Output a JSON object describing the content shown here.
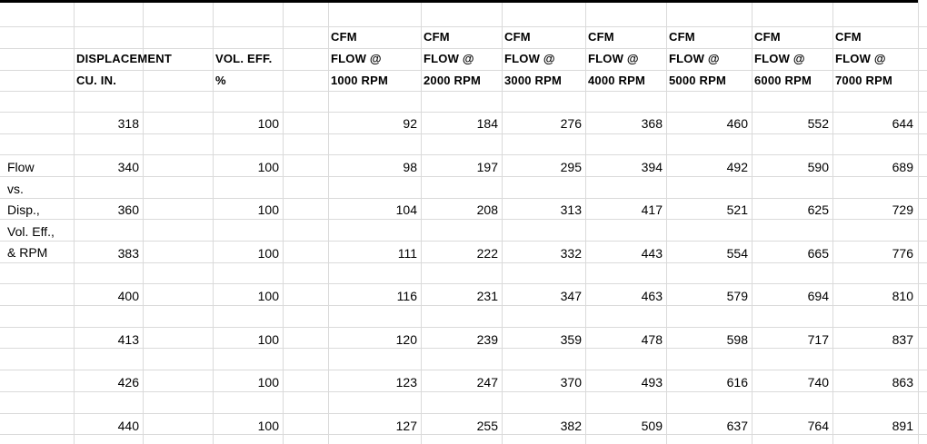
{
  "sheet": {
    "side_label": [
      "Flow",
      "vs.",
      "Disp.,",
      "Vol. Eff.,",
      "& RPM"
    ],
    "headers": [
      [
        "DISPLACEMENT",
        "CU. IN."
      ],
      [
        "VOL. EFF.",
        "%"
      ],
      [
        "CFM",
        "FLOW @",
        "1000 RPM"
      ],
      [
        "CFM",
        "FLOW @",
        "2000 RPM"
      ],
      [
        "CFM",
        "FLOW @",
        "3000 RPM"
      ],
      [
        "CFM",
        "FLOW @",
        "4000 RPM"
      ],
      [
        "CFM",
        "FLOW @",
        "5000 RPM"
      ],
      [
        "CFM",
        "FLOW @",
        "6000 RPM"
      ],
      [
        "CFM",
        "FLOW @",
        "7000 RPM"
      ]
    ],
    "rows": [
      [
        "318",
        "100",
        "92",
        "184",
        "276",
        "368",
        "460",
        "552",
        "644"
      ],
      [
        "340",
        "100",
        "98",
        "197",
        "295",
        "394",
        "492",
        "590",
        "689"
      ],
      [
        "360",
        "100",
        "104",
        "208",
        "313",
        "417",
        "521",
        "625",
        "729"
      ],
      [
        "383",
        "100",
        "111",
        "222",
        "332",
        "443",
        "554",
        "665",
        "776"
      ],
      [
        "400",
        "100",
        "116",
        "231",
        "347",
        "463",
        "579",
        "694",
        "810"
      ],
      [
        "413",
        "100",
        "120",
        "239",
        "359",
        "478",
        "598",
        "717",
        "837"
      ],
      [
        "426",
        "100",
        "123",
        "247",
        "370",
        "493",
        "616",
        "740",
        "863"
      ],
      [
        "440",
        "100",
        "127",
        "255",
        "382",
        "509",
        "637",
        "764",
        "891"
      ]
    ]
  }
}
